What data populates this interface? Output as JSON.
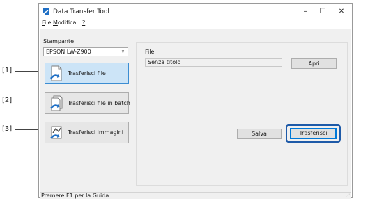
{
  "callouts": [
    "[1]",
    "[2]",
    "[3]"
  ],
  "window": {
    "title": "Data Transfer Tool",
    "controls": {
      "minimize": "–",
      "maximize": "☐",
      "close": "✕"
    }
  },
  "menu": [
    {
      "underline": "F",
      "rest": "ile"
    },
    {
      "underline": "M",
      "rest": "odifica"
    },
    {
      "underline": "?",
      "rest": ""
    }
  ],
  "printer": {
    "label": "Stampante",
    "value": "EPSON LW-Z900"
  },
  "actions": {
    "transfer_file": "Trasferisci file",
    "transfer_batch": "Trasferisci file in batch",
    "transfer_images": "Trasferisci immagini",
    "selected": "transfer_file"
  },
  "file_panel": {
    "label": "File",
    "value": "Senza titolo",
    "open_label": "Apri",
    "save_label": "Salva",
    "transfer_label": "Trasferisci"
  },
  "status": "Premere F1 per la Guida.",
  "colors": {
    "accent": "#1e5aa8",
    "selected_bg": "#cce4f7"
  }
}
